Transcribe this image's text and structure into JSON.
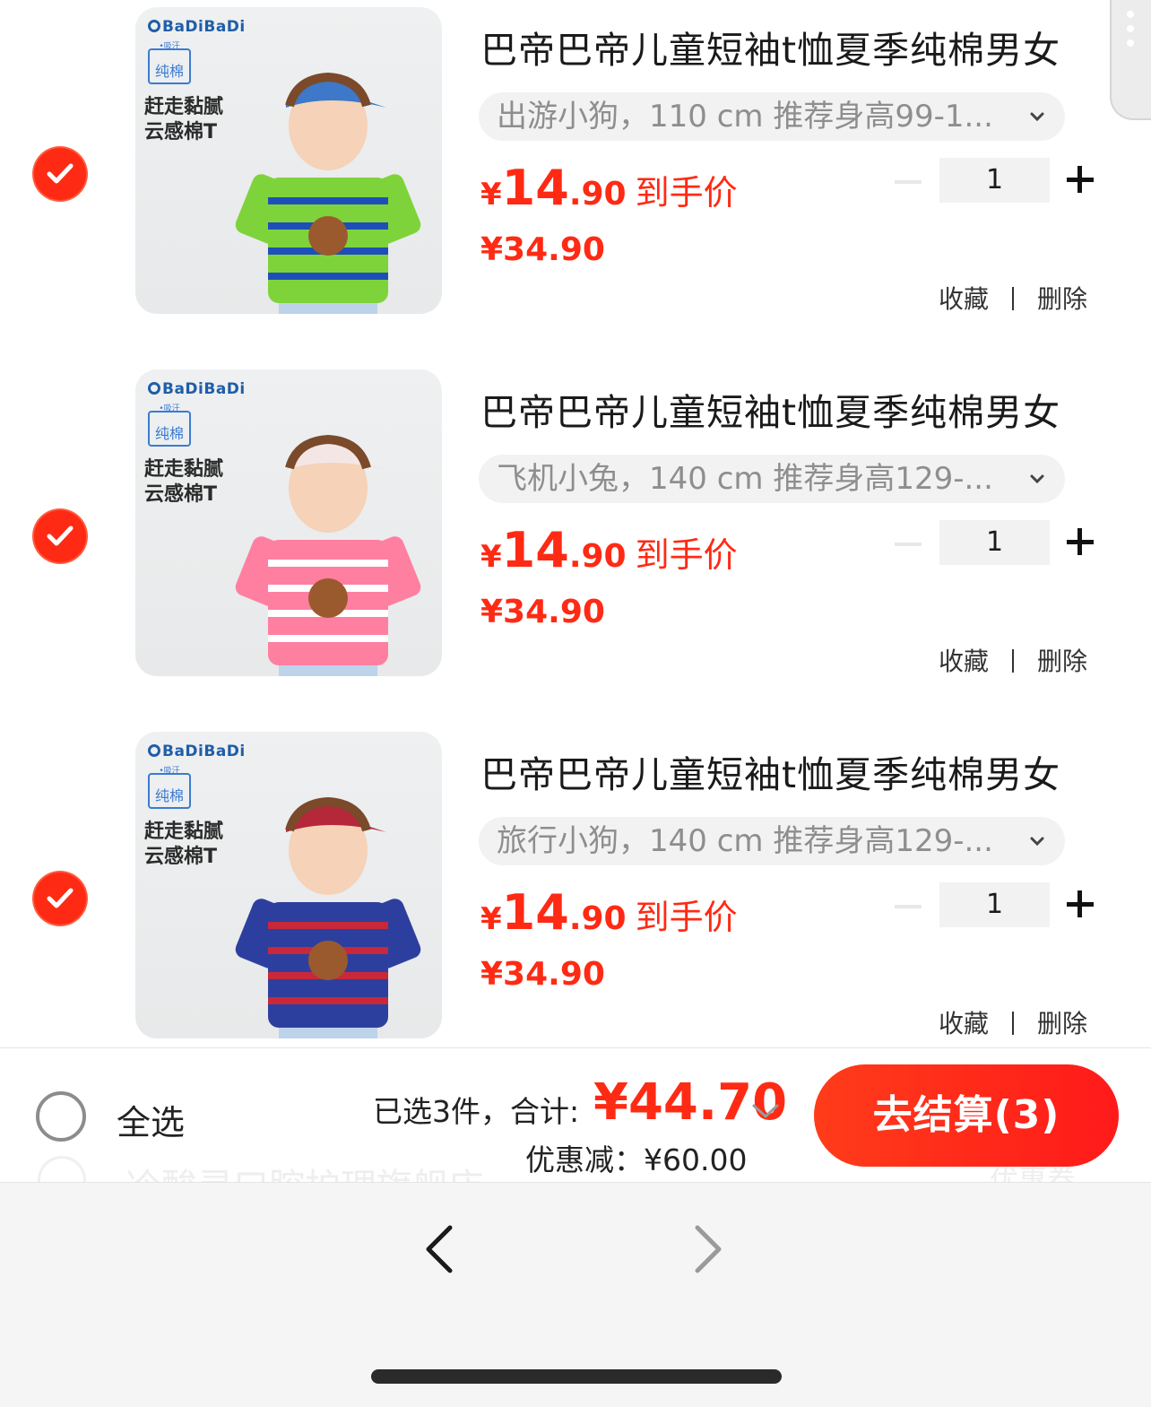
{
  "cart_items": [
    {
      "thumb": {
        "brand": "BaDiBaDi",
        "badge": "纯棉",
        "tagline_1": "赶走黏腻",
        "tagline_2": "云感棉T",
        "shirt_color": "#7fd33a",
        "shirt_color_2": "#1e4fb8",
        "cap_color": "#3d78c9"
      },
      "title": "巴帝巴帝儿童短袖t恤夏季纯棉男女",
      "spec": "出游小狗，110 cm 推荐身高99-1...",
      "price_symbol": "¥",
      "price_int": "14",
      "price_dec": ".90",
      "price_label": "到手价",
      "original_price": "¥34.90",
      "quantity": "1",
      "favorite_label": "收藏",
      "delete_label": "删除"
    },
    {
      "thumb": {
        "brand": "BaDiBaDi",
        "badge": "纯棉",
        "tagline_1": "赶走黏腻",
        "tagline_2": "云感棉T",
        "shirt_color": "#ff7fa0",
        "shirt_color_2": "#ffffff",
        "cap_color": "#f5e6e6"
      },
      "title": "巴帝巴帝儿童短袖t恤夏季纯棉男女",
      "spec": "飞机小兔，140 cm 推荐身高129-...",
      "price_symbol": "¥",
      "price_int": "14",
      "price_dec": ".90",
      "price_label": "到手价",
      "original_price": "¥34.90",
      "quantity": "1",
      "favorite_label": "收藏",
      "delete_label": "删除"
    },
    {
      "thumb": {
        "brand": "BaDiBaDi",
        "badge": "纯棉",
        "tagline_1": "赶走黏腻",
        "tagline_2": "云感棉T",
        "shirt_color": "#2d3f9e",
        "shirt_color_2": "#c8283a",
        "cap_color": "#b4283a"
      },
      "title": "巴帝巴帝儿童短袖t恤夏季纯棉男女",
      "spec": "旅行小狗，140 cm 推荐身高129-...",
      "price_symbol": "¥",
      "price_int": "14",
      "price_dec": ".90",
      "price_label": "到手价",
      "original_price": "¥34.90",
      "quantity": "1",
      "favorite_label": "收藏",
      "delete_label": "删除"
    }
  ],
  "footer": {
    "select_all_label": "全选",
    "summary_label": "已选3件，合计:",
    "total": "¥44.70",
    "discount_label": "优惠减：",
    "discount_value": "¥60.00",
    "checkout_label": "去结算(3)",
    "hidden_store_text": "冷酸灵口腔护理旗舰店",
    "hidden_right_text": "优惠券"
  },
  "colors": {
    "accent": "#ff2a14",
    "spec_bg": "#f2f2f2",
    "nav_bg": "#f5f5f5"
  },
  "icons": {
    "selected": "check-circle-icon",
    "menu": "more-vertical-icon",
    "back": "chevron-left-icon",
    "forward": "chevron-right-icon"
  }
}
